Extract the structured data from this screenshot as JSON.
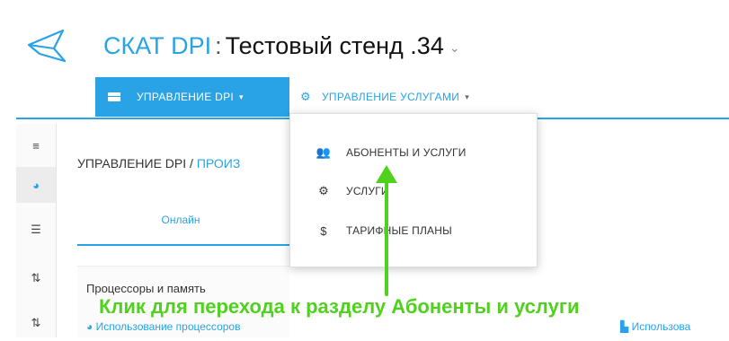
{
  "header": {
    "brand": "СКАТ DPI",
    "separator": ":",
    "stand": "Тестовый стенд .34",
    "caret": "⌄"
  },
  "nav": {
    "dpi_label": "УПРАВЛЕНИЕ DPI",
    "dpi_caret": "▾",
    "services_label": "УПРАВЛЕНИЕ УСЛУГАМИ",
    "services_caret": "▾"
  },
  "dropdown": {
    "items": [
      {
        "label": "АБОНЕНТЫ И УСЛУГИ",
        "icon": "users-icon"
      },
      {
        "label": "УСЛУГИ",
        "icon": "cogs-icon"
      },
      {
        "label": "ТАРИФНЫЕ ПЛАНЫ",
        "icon": "dollar-icon"
      }
    ]
  },
  "breadcrumb": {
    "root": "УПРАВЛЕНИЕ DPI",
    "slash": " / ",
    "current": "ПРОИЗ"
  },
  "tabs": {
    "online": "Онлайн"
  },
  "content": {
    "section_title": "Процессоры и память",
    "cpu_usage": "Использование процессоров",
    "right_usage": "Использова"
  },
  "annotation": {
    "text": "Клик для перехода к разделу Абоненты и услуги"
  },
  "colors": {
    "accent": "#2aa3e6",
    "annotation": "#4fd11e"
  }
}
